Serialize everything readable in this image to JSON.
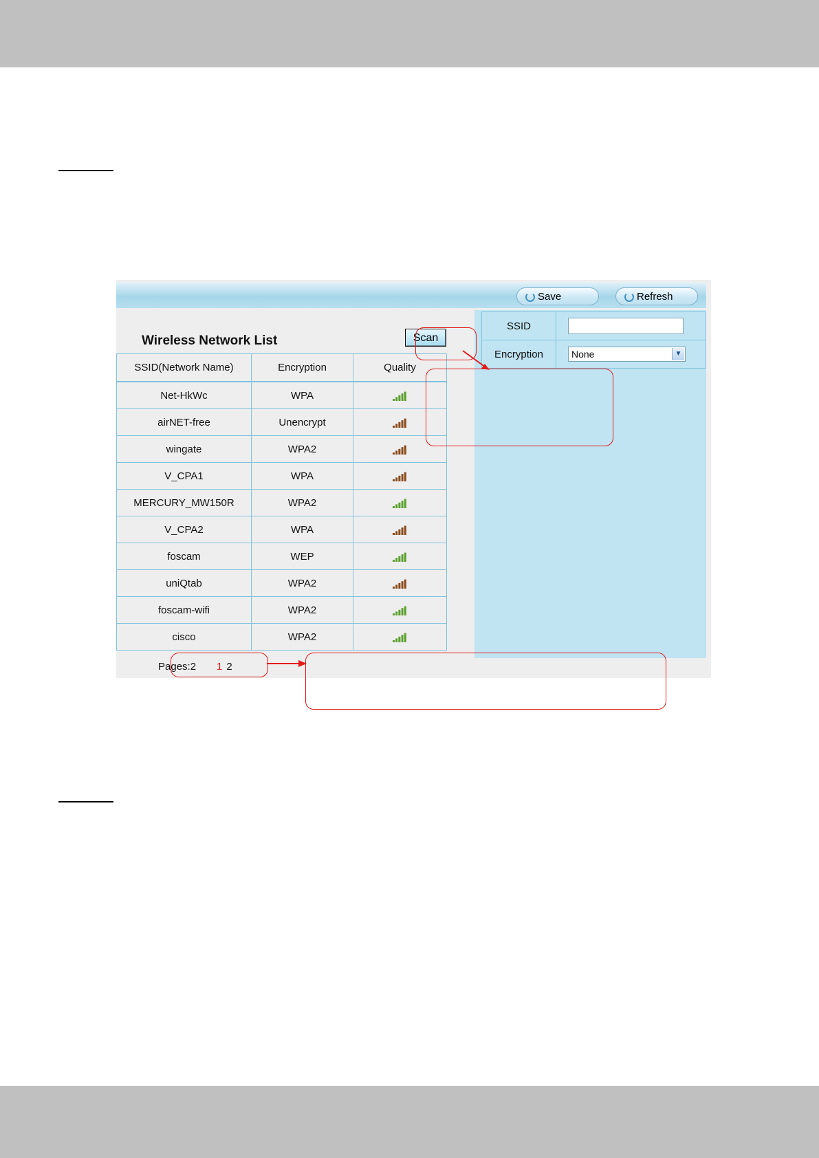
{
  "toolbar": {
    "save_label": "Save",
    "refresh_label": "Refresh"
  },
  "network_list": {
    "title": "Wireless Network List",
    "scan_label": "Scan",
    "headers": [
      "SSID(Network Name)",
      "Encryption",
      "Quality"
    ],
    "rows": [
      {
        "ssid": "Net-HkWc",
        "encryption": "WPA",
        "quality": 4,
        "quality_color": "#5aa02c"
      },
      {
        "ssid": "airNET-free",
        "encryption": "Unencrypt",
        "quality": 4,
        "quality_color": "#8a4a1a"
      },
      {
        "ssid": "wingate",
        "encryption": "WPA2",
        "quality": 4,
        "quality_color": "#8a4a1a"
      },
      {
        "ssid": "V_CPA1",
        "encryption": "WPA",
        "quality": 4,
        "quality_color": "#8a4a1a"
      },
      {
        "ssid": "MERCURY_MW150R",
        "encryption": "WPA2",
        "quality": 4,
        "quality_color": "#5aa02c"
      },
      {
        "ssid": "V_CPA2",
        "encryption": "WPA",
        "quality": 4,
        "quality_color": "#8a4a1a"
      },
      {
        "ssid": "foscam",
        "encryption": "WEP",
        "quality": 4,
        "quality_color": "#5aa02c"
      },
      {
        "ssid": "uniQtab",
        "encryption": "WPA2",
        "quality": 4,
        "quality_color": "#8a4a1a"
      },
      {
        "ssid": "foscam-wifi",
        "encryption": "WPA2",
        "quality": 4,
        "quality_color": "#5aa02c"
      },
      {
        "ssid": "cisco",
        "encryption": "WPA2",
        "quality": 4,
        "quality_color": "#5aa02c"
      }
    ],
    "pages_label": "Pages:2",
    "pages": [
      "1",
      "2"
    ],
    "current_page": "1"
  },
  "settings": {
    "ssid_label": "SSID",
    "ssid_value": "",
    "encryption_label": "Encryption",
    "encryption_value": "None"
  },
  "colors": {
    "callout": "#e31b1b",
    "current_page": "#e02020",
    "panel_blue": "#c0e4f2"
  }
}
